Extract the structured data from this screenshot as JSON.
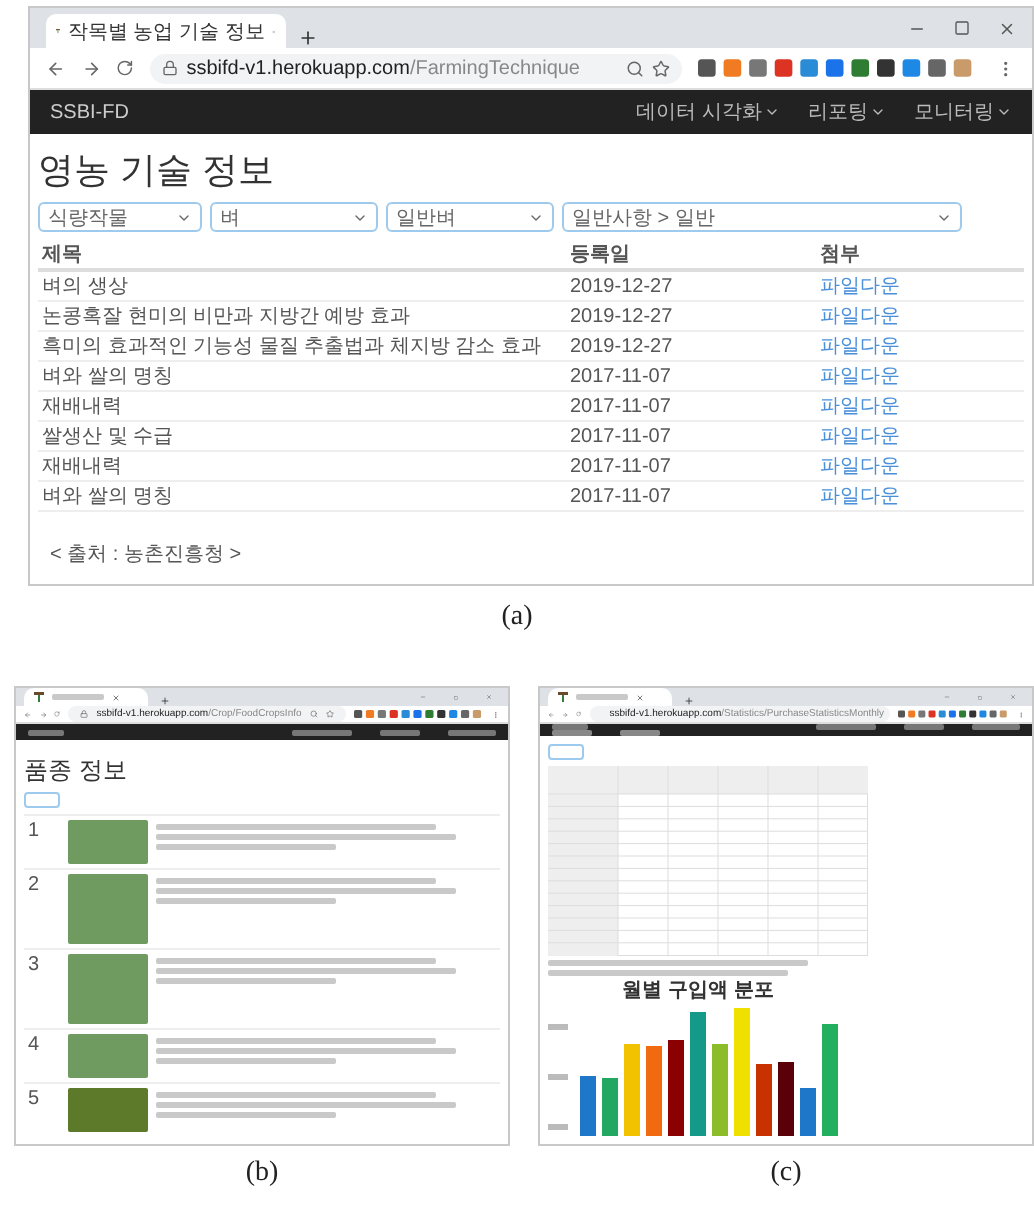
{
  "panel_a": {
    "caption": "(a)",
    "tab_title": "작목별 농업 기술 정보",
    "url": {
      "host": "ssbifd-v1.herokuapp.com",
      "path": "/FarmingTechnique"
    },
    "brand": "SSBI-FD",
    "nav_menus": [
      "데이터 시각화",
      "리포팅",
      "모니터링"
    ],
    "heading": "영농 기술 정보",
    "filters": [
      {
        "value": "식량작물"
      },
      {
        "value": "벼"
      },
      {
        "value": "일반벼"
      },
      {
        "value": "일반사항 > 일반"
      }
    ],
    "table": {
      "columns": [
        "제목",
        "등록일",
        "첨부"
      ],
      "rows": [
        {
          "title": "벼의 생상",
          "date": "2019-12-27",
          "attachment": "파일다운"
        },
        {
          "title": "논콩혹잘 현미의 비만과 지방간 예방 효과",
          "date": "2019-12-27",
          "attachment": "파일다운"
        },
        {
          "title": "흑미의 효과적인 기능성 물질 추출법과 체지방 감소 효과",
          "date": "2019-12-27",
          "attachment": "파일다운"
        },
        {
          "title": "벼와 쌀의 명칭",
          "date": "2017-11-07",
          "attachment": "파일다운"
        },
        {
          "title": "재배내력",
          "date": "2017-11-07",
          "attachment": "파일다운"
        },
        {
          "title": "쌀생산 및 수급",
          "date": "2017-11-07",
          "attachment": "파일다운"
        },
        {
          "title": "재배내력",
          "date": "2017-11-07",
          "attachment": "파일다운"
        },
        {
          "title": "벼와 쌀의 명칭",
          "date": "2017-11-07",
          "attachment": "파일다운"
        }
      ]
    },
    "source": "< 출처 : 농촌진흥청 >"
  },
  "panel_b": {
    "caption": "(b)",
    "url": {
      "host": "ssbifd-v1.herokuapp.com",
      "path": "/Crop/FoodCropsInfo"
    },
    "heading": "품종 정보",
    "rows": [
      {
        "number": "1"
      },
      {
        "number": "2"
      },
      {
        "number": "3"
      },
      {
        "number": "4"
      },
      {
        "number": "5"
      }
    ]
  },
  "panel_c": {
    "caption": "(c)",
    "url": {
      "host": "ssbifd-v1.herokuapp.com",
      "path": "/Statistics/PurchaseStatisticsMonthly"
    },
    "chart_title": "월별 구입액 분포"
  }
}
